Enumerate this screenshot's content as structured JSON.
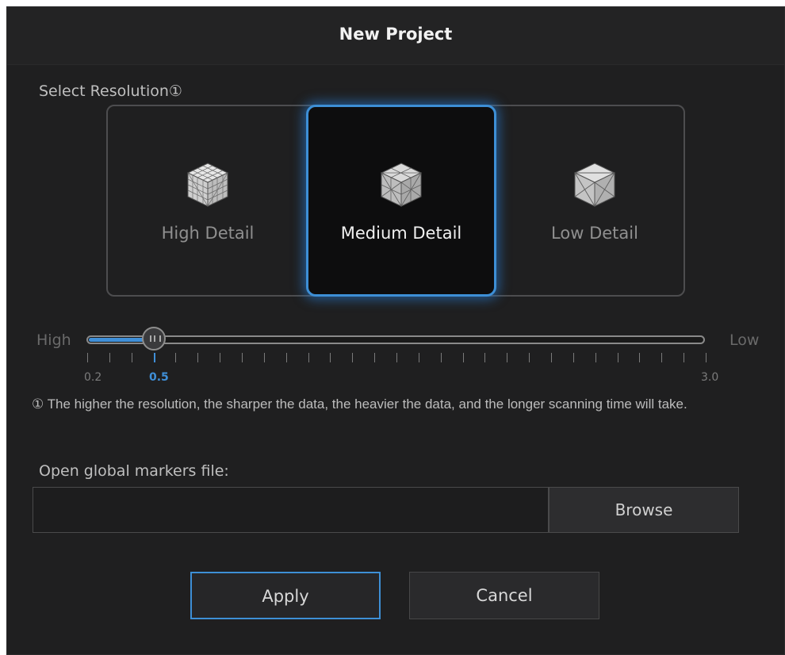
{
  "dialog": {
    "title": "New Project"
  },
  "resolution": {
    "label": "Select Resolution①",
    "options": [
      {
        "label": "High Detail",
        "icon": "dense-mesh-cube-icon",
        "selected": false
      },
      {
        "label": "Medium Detail",
        "icon": "medium-mesh-cube-icon",
        "selected": true
      },
      {
        "label": "Low Detail",
        "icon": "sparse-mesh-cube-icon",
        "selected": false
      }
    ]
  },
  "slider": {
    "left_label": "High",
    "right_label": "Low",
    "min_label": "0.2",
    "value_label": "0.5",
    "max_label": "3.0",
    "min": 0.2,
    "max": 3.0,
    "value": 0.5,
    "accent_color": "#3f8fd8"
  },
  "note": "① The higher the resolution, the sharper the data, the heavier the data, and the longer scanning time will take.",
  "markers": {
    "label": "Open global markers file:",
    "value": "",
    "browse_label": "Browse"
  },
  "buttons": {
    "apply": "Apply",
    "cancel": "Cancel"
  }
}
